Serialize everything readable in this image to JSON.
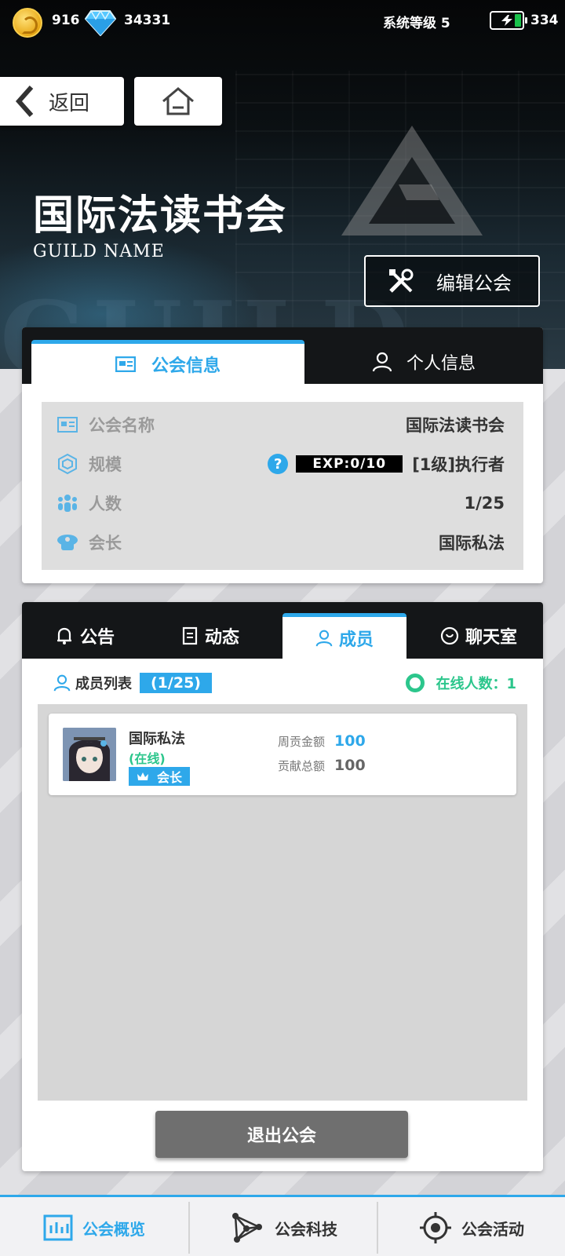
{
  "status_bar": {
    "coins": "916",
    "gems": "34331",
    "system_level": "系统等级 5",
    "energy": "334"
  },
  "nav": {
    "back_label": "返回"
  },
  "guild": {
    "name": "国际法读书会",
    "subtitle": "GUILD NAME",
    "edit_label": "编辑公会"
  },
  "info_panel": {
    "tabs": [
      {
        "label": "公会信息",
        "active": true
      },
      {
        "label": "个人信息",
        "active": false
      }
    ],
    "rows": [
      {
        "label": "公会名称",
        "value": "国际法读书会",
        "icon": "id-card-icon"
      },
      {
        "label": "规模",
        "exp": "EXP:0/10",
        "value": "[1级]执行者",
        "icon": "cube-icon"
      },
      {
        "label": "人数",
        "value": "1/25",
        "icon": "people-icon"
      },
      {
        "label": "会长",
        "value": "国际私法",
        "icon": "captain-hat-icon"
      }
    ]
  },
  "members_panel": {
    "tabs": [
      {
        "label": "公告",
        "icon": "bell-icon",
        "active": false
      },
      {
        "label": "动态",
        "icon": "note-icon",
        "active": false
      },
      {
        "label": "成员",
        "icon": "user-icon",
        "active": true
      },
      {
        "label": "聊天室",
        "icon": "chat-icon",
        "active": false
      }
    ],
    "list_title": "成员列表",
    "list_count": "(1/25)",
    "online_count": "在线人数：1",
    "members": [
      {
        "name": "国际私法",
        "status": "(在线)",
        "role": "会长",
        "weekly_label": "周贡金额",
        "weekly_value": "100",
        "total_label": "贡献总额",
        "total_value": "100"
      }
    ],
    "quit_label": "退出公会"
  },
  "bottom_nav": [
    {
      "label": "公会概览",
      "icon": "chart-icon",
      "active": true
    },
    {
      "label": "公会科技",
      "icon": "network-icon",
      "active": false
    },
    {
      "label": "公会活动",
      "icon": "target-icon",
      "active": false
    }
  ],
  "colors": {
    "accent": "#2ea8ea",
    "online": "#2cc68c",
    "dark": "#141618"
  }
}
